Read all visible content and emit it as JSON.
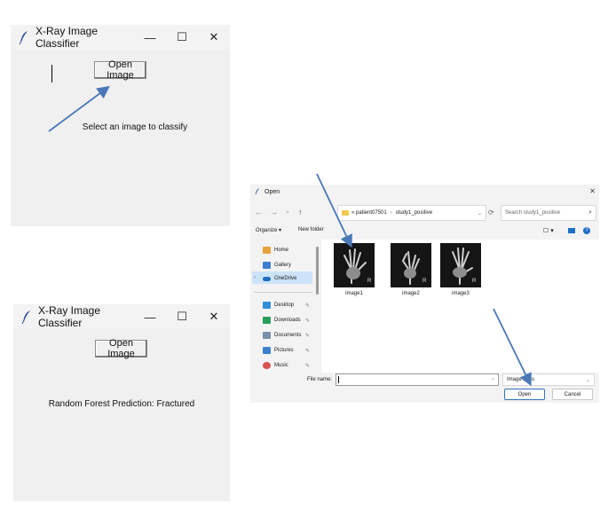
{
  "window_top": {
    "title": "X-Ray Image Classifier",
    "minimize": "—",
    "maximize": "☐",
    "close": "✕",
    "open_button": "Open Image",
    "status": "Select an image to classify"
  },
  "window_bottom": {
    "title": "X-Ray Image Classifier",
    "minimize": "—",
    "maximize": "☐",
    "close": "✕",
    "open_button": "Open Image",
    "status": "Random Forest Prediction: Fractured"
  },
  "dialog": {
    "title": "Open",
    "close": "✕",
    "nav": {
      "back": "←",
      "forward": "→",
      "recent": "⌄",
      "up": "↑"
    },
    "breadcrumb": [
      "« patient07501",
      "study1_positive"
    ],
    "search_placeholder": "Search study1_positive",
    "organize": "Organize ▾",
    "new_folder": "New folder",
    "sidebar": [
      "Home",
      "Gallery",
      "OneDrive",
      "Desktop",
      "Downloads",
      "Documents",
      "Pictures",
      "Music"
    ],
    "files": [
      "image1",
      "image2",
      "image3"
    ],
    "file_name_label": "File name:",
    "file_name_value": "",
    "file_type": "Image Files",
    "open_button": "Open",
    "cancel_button": "Cancel"
  },
  "colors": {
    "accent": "#2f74c0",
    "arrow": "#4a78b8",
    "window_bg": "#f0f0f0"
  }
}
